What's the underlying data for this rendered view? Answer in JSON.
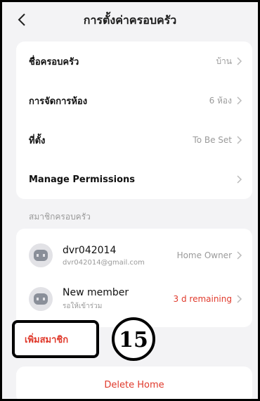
{
  "header": {
    "title": "การตั้งค่าครอบครัว",
    "back_icon": "chevron-left-icon"
  },
  "settings": {
    "items": [
      {
        "label": "ชื่อครอบครัว",
        "value": "บ้าน"
      },
      {
        "label": "การจัดการห้อง",
        "value": "6 ห้อง"
      },
      {
        "label": "ที่ตั้ง",
        "value": "To Be Set"
      },
      {
        "label": "Manage Permissions",
        "value": ""
      }
    ]
  },
  "members": {
    "section_title": "สมาชิกครอบครัว",
    "list": [
      {
        "name": "dvr042014",
        "sub": "dvr042014@gmail.com",
        "status": "Home Owner"
      },
      {
        "name": "New member",
        "sub": "รอให้เข้าร่วม",
        "status": "3 d remaining"
      }
    ],
    "add_label": "เพิ่มสมาชิก"
  },
  "annotation": {
    "step_number": "15"
  },
  "footer": {
    "delete_label": "Delete Home"
  },
  "colors": {
    "accent": "#e0392b",
    "background": "#f3f3f5",
    "card": "#ffffff",
    "muted": "#9a9a9a"
  }
}
